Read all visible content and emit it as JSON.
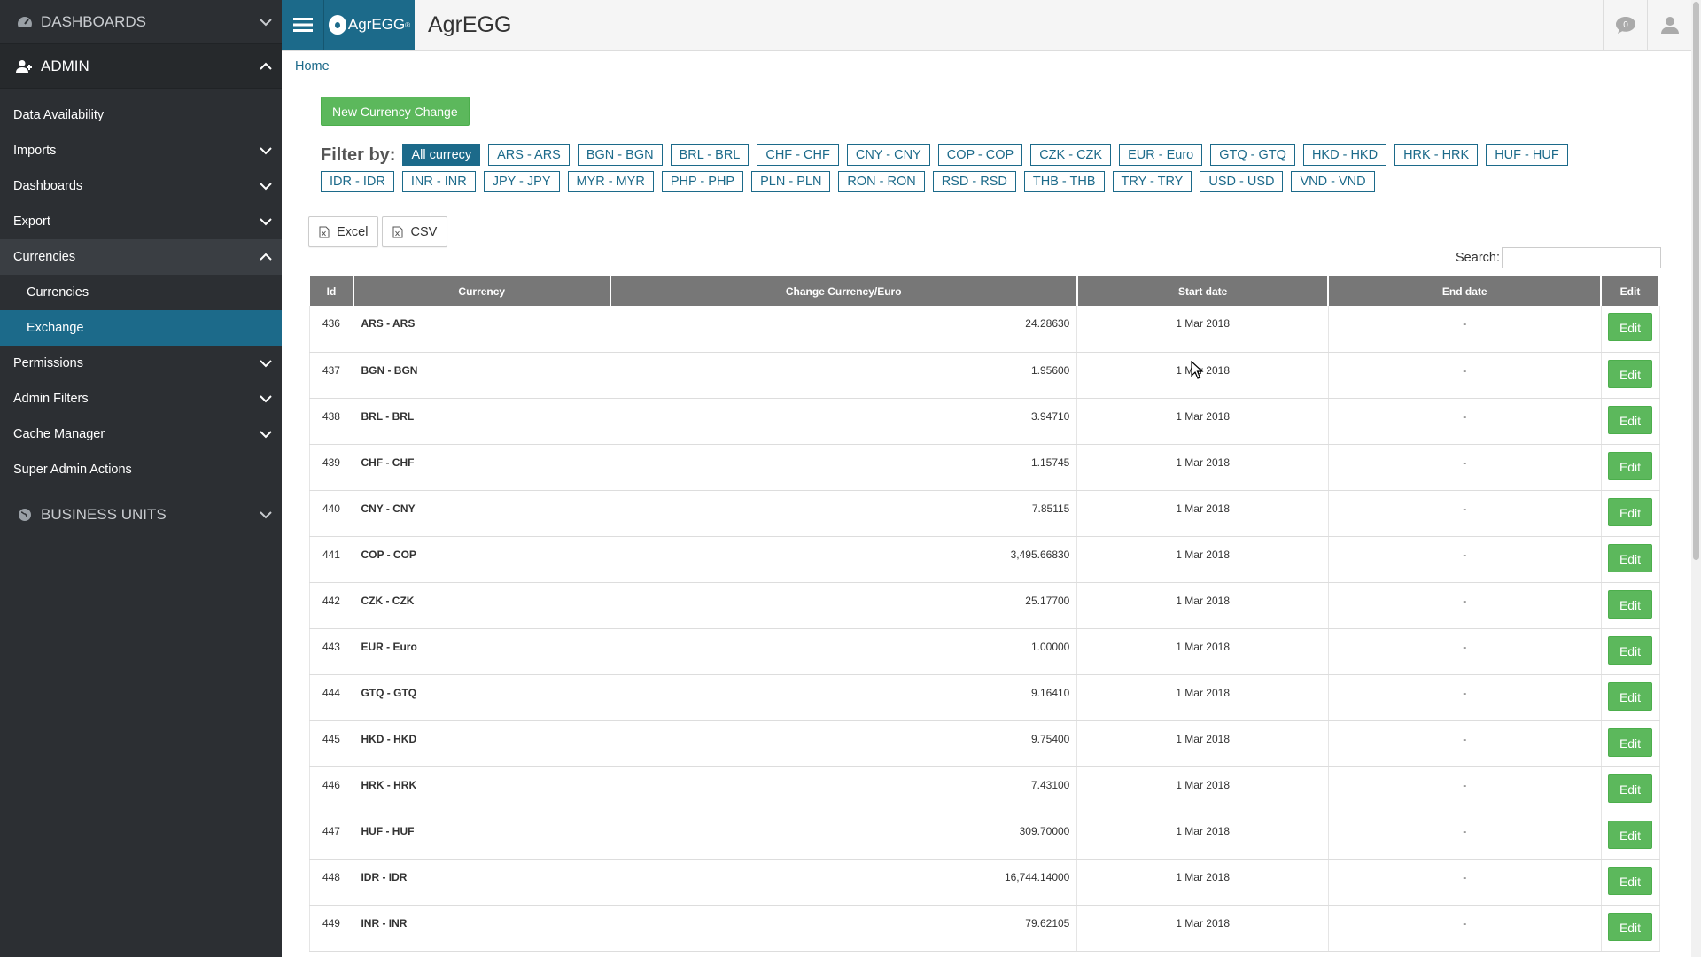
{
  "sidebar": {
    "dashboards_title": "DASHBOARDS",
    "admin_title": "ADMIN",
    "items": [
      {
        "label": "Data Availability"
      },
      {
        "label": "Imports"
      },
      {
        "label": "Dashboards"
      },
      {
        "label": "Export"
      },
      {
        "label": "Currencies"
      },
      {
        "label": "Currencies"
      },
      {
        "label": "Exchange"
      },
      {
        "label": "Permissions"
      },
      {
        "label": "Admin Filters"
      },
      {
        "label": "Cache Manager"
      },
      {
        "label": "Super Admin Actions"
      }
    ],
    "business_units_title": "BUSINESS UNITS"
  },
  "topbar": {
    "logo_text": "AgrEGG",
    "logo_mark": "®",
    "app_title": "AgrEGG",
    "notification_count": "0"
  },
  "breadcrumb": {
    "home": "Home"
  },
  "new_button_label": "New Currency Change",
  "filter": {
    "label": "Filter by:",
    "chips": [
      "All currecy",
      "ARS - ARS",
      "BGN - BGN",
      "BRL - BRL",
      "CHF - CHF",
      "CNY - CNY",
      "COP - COP",
      "CZK - CZK",
      "EUR - Euro",
      "GTQ - GTQ",
      "HKD - HKD",
      "HRK - HRK",
      "HUF - HUF",
      "IDR - IDR",
      "INR - INR",
      "JPY - JPY",
      "MYR - MYR",
      "PHP - PHP",
      "PLN - PLN",
      "RON - RON",
      "RSD - RSD",
      "THB - THB",
      "TRY - TRY",
      "USD - USD",
      "VND - VND"
    ]
  },
  "export": {
    "excel": "Excel",
    "csv": "CSV"
  },
  "search": {
    "label": "Search:",
    "value": ""
  },
  "table": {
    "headers": [
      "Id",
      "Currency",
      "Change Currency/Euro",
      "Start date",
      "End date",
      "Edit"
    ],
    "edit_label": "Edit",
    "rows": [
      {
        "id": "436",
        "currency": "ARS - ARS",
        "rate": "24.28630",
        "start": "1 Mar 2018",
        "end": "-"
      },
      {
        "id": "437",
        "currency": "BGN - BGN",
        "rate": "1.95600",
        "start": "1 Mar 2018",
        "end": "-"
      },
      {
        "id": "438",
        "currency": "BRL - BRL",
        "rate": "3.94710",
        "start": "1 Mar 2018",
        "end": "-"
      },
      {
        "id": "439",
        "currency": "CHF - CHF",
        "rate": "1.15745",
        "start": "1 Mar 2018",
        "end": "-"
      },
      {
        "id": "440",
        "currency": "CNY - CNY",
        "rate": "7.85115",
        "start": "1 Mar 2018",
        "end": "-"
      },
      {
        "id": "441",
        "currency": "COP - COP",
        "rate": "3,495.66830",
        "start": "1 Mar 2018",
        "end": "-"
      },
      {
        "id": "442",
        "currency": "CZK - CZK",
        "rate": "25.17700",
        "start": "1 Mar 2018",
        "end": "-"
      },
      {
        "id": "443",
        "currency": "EUR - Euro",
        "rate": "1.00000",
        "start": "1 Mar 2018",
        "end": "-"
      },
      {
        "id": "444",
        "currency": "GTQ - GTQ",
        "rate": "9.16410",
        "start": "1 Mar 2018",
        "end": "-"
      },
      {
        "id": "445",
        "currency": "HKD - HKD",
        "rate": "9.75400",
        "start": "1 Mar 2018",
        "end": "-"
      },
      {
        "id": "446",
        "currency": "HRK - HRK",
        "rate": "7.43100",
        "start": "1 Mar 2018",
        "end": "-"
      },
      {
        "id": "447",
        "currency": "HUF - HUF",
        "rate": "309.70000",
        "start": "1 Mar 2018",
        "end": "-"
      },
      {
        "id": "448",
        "currency": "IDR - IDR",
        "rate": "16,744.14000",
        "start": "1 Mar 2018",
        "end": "-"
      },
      {
        "id": "449",
        "currency": "INR - INR",
        "rate": "79.62105",
        "start": "1 Mar 2018",
        "end": "-"
      }
    ]
  },
  "colors": {
    "primary": "#1c6a8a",
    "success": "#5cb85c",
    "sidebar": "#2c2f33",
    "header_cell": "#777777"
  }
}
